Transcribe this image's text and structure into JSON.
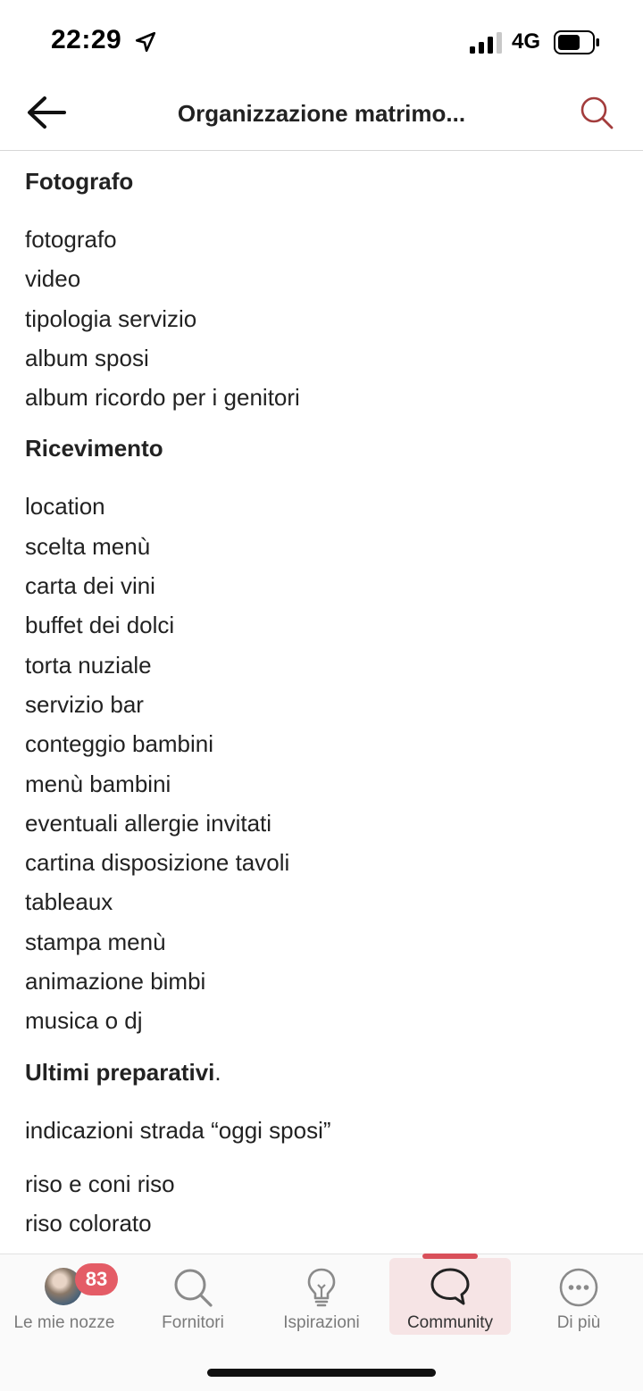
{
  "status_bar": {
    "time": "22:29",
    "network": "4G"
  },
  "header": {
    "title": "Organizzazione matrimo..."
  },
  "sections": [
    {
      "title": "Fotografo",
      "items": [
        "fotografo",
        "video",
        "tipologia servizio",
        "album sposi",
        "album ricordo per i genitori"
      ]
    },
    {
      "title": "Ricevimento",
      "items": [
        "location",
        "scelta menù",
        "carta dei vini",
        "buffet dei dolci",
        "torta nuziale",
        "servizio bar",
        "conteggio bambini",
        "menù bambini",
        "eventuali allergie invitati",
        "cartina disposizione tavoli",
        "tableaux",
        "stampa menù",
        "animazione bimbi",
        "musica o dj"
      ]
    },
    {
      "title": "Ultimi preparativi",
      "title_suffix": ".",
      "intro": "indicazioni strada “oggi sposi”",
      "items": [
        "riso e coni riso",
        "riso colorato"
      ]
    }
  ],
  "tabbar": {
    "tabs": [
      {
        "label": "Le mie nozze",
        "icon": "avatar"
      },
      {
        "label": "Fornitori",
        "icon": "search-icon"
      },
      {
        "label": "Ispirazioni",
        "icon": "lightbulb-icon"
      },
      {
        "label": "Community",
        "icon": "chat-bubble-icon"
      },
      {
        "label": "Di più",
        "icon": "more-icon"
      }
    ],
    "active_tab": "Community",
    "badge_count": "83"
  },
  "colors": {
    "accent": "#d9505a",
    "search_icon": "#a33c3c",
    "badge": "#e45c66",
    "active_tab_bg": "#f6e4e5"
  }
}
